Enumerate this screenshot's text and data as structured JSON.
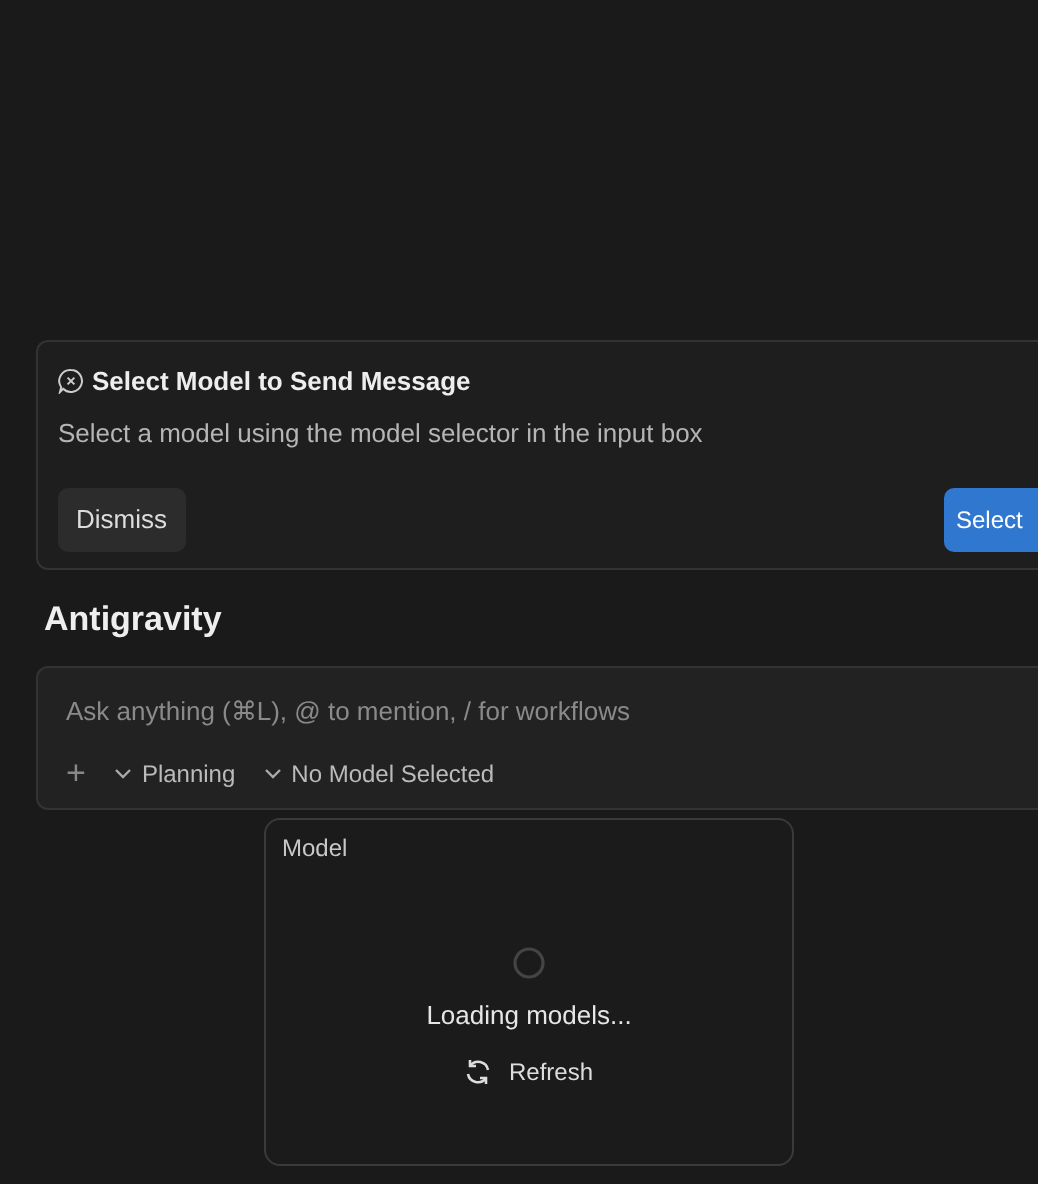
{
  "notice": {
    "title": "Select Model to Send Message",
    "message": "Select a model using the model selector in the input box",
    "buttons": [
      {
        "label": "Dismiss",
        "kind": "secondary"
      },
      {
        "label": "Select",
        "kind": "primary"
      }
    ]
  },
  "heading": "Antigravity",
  "composer": {
    "placeholder": "Ask anything (⌘L), @ to mention, / for workflows",
    "add": "+",
    "dropdowns": [
      {
        "label": "Planning"
      },
      {
        "label": "No Model Selected"
      }
    ]
  },
  "model_popup": {
    "title": "Model",
    "status": "Loading models...",
    "action": "Refresh"
  }
}
